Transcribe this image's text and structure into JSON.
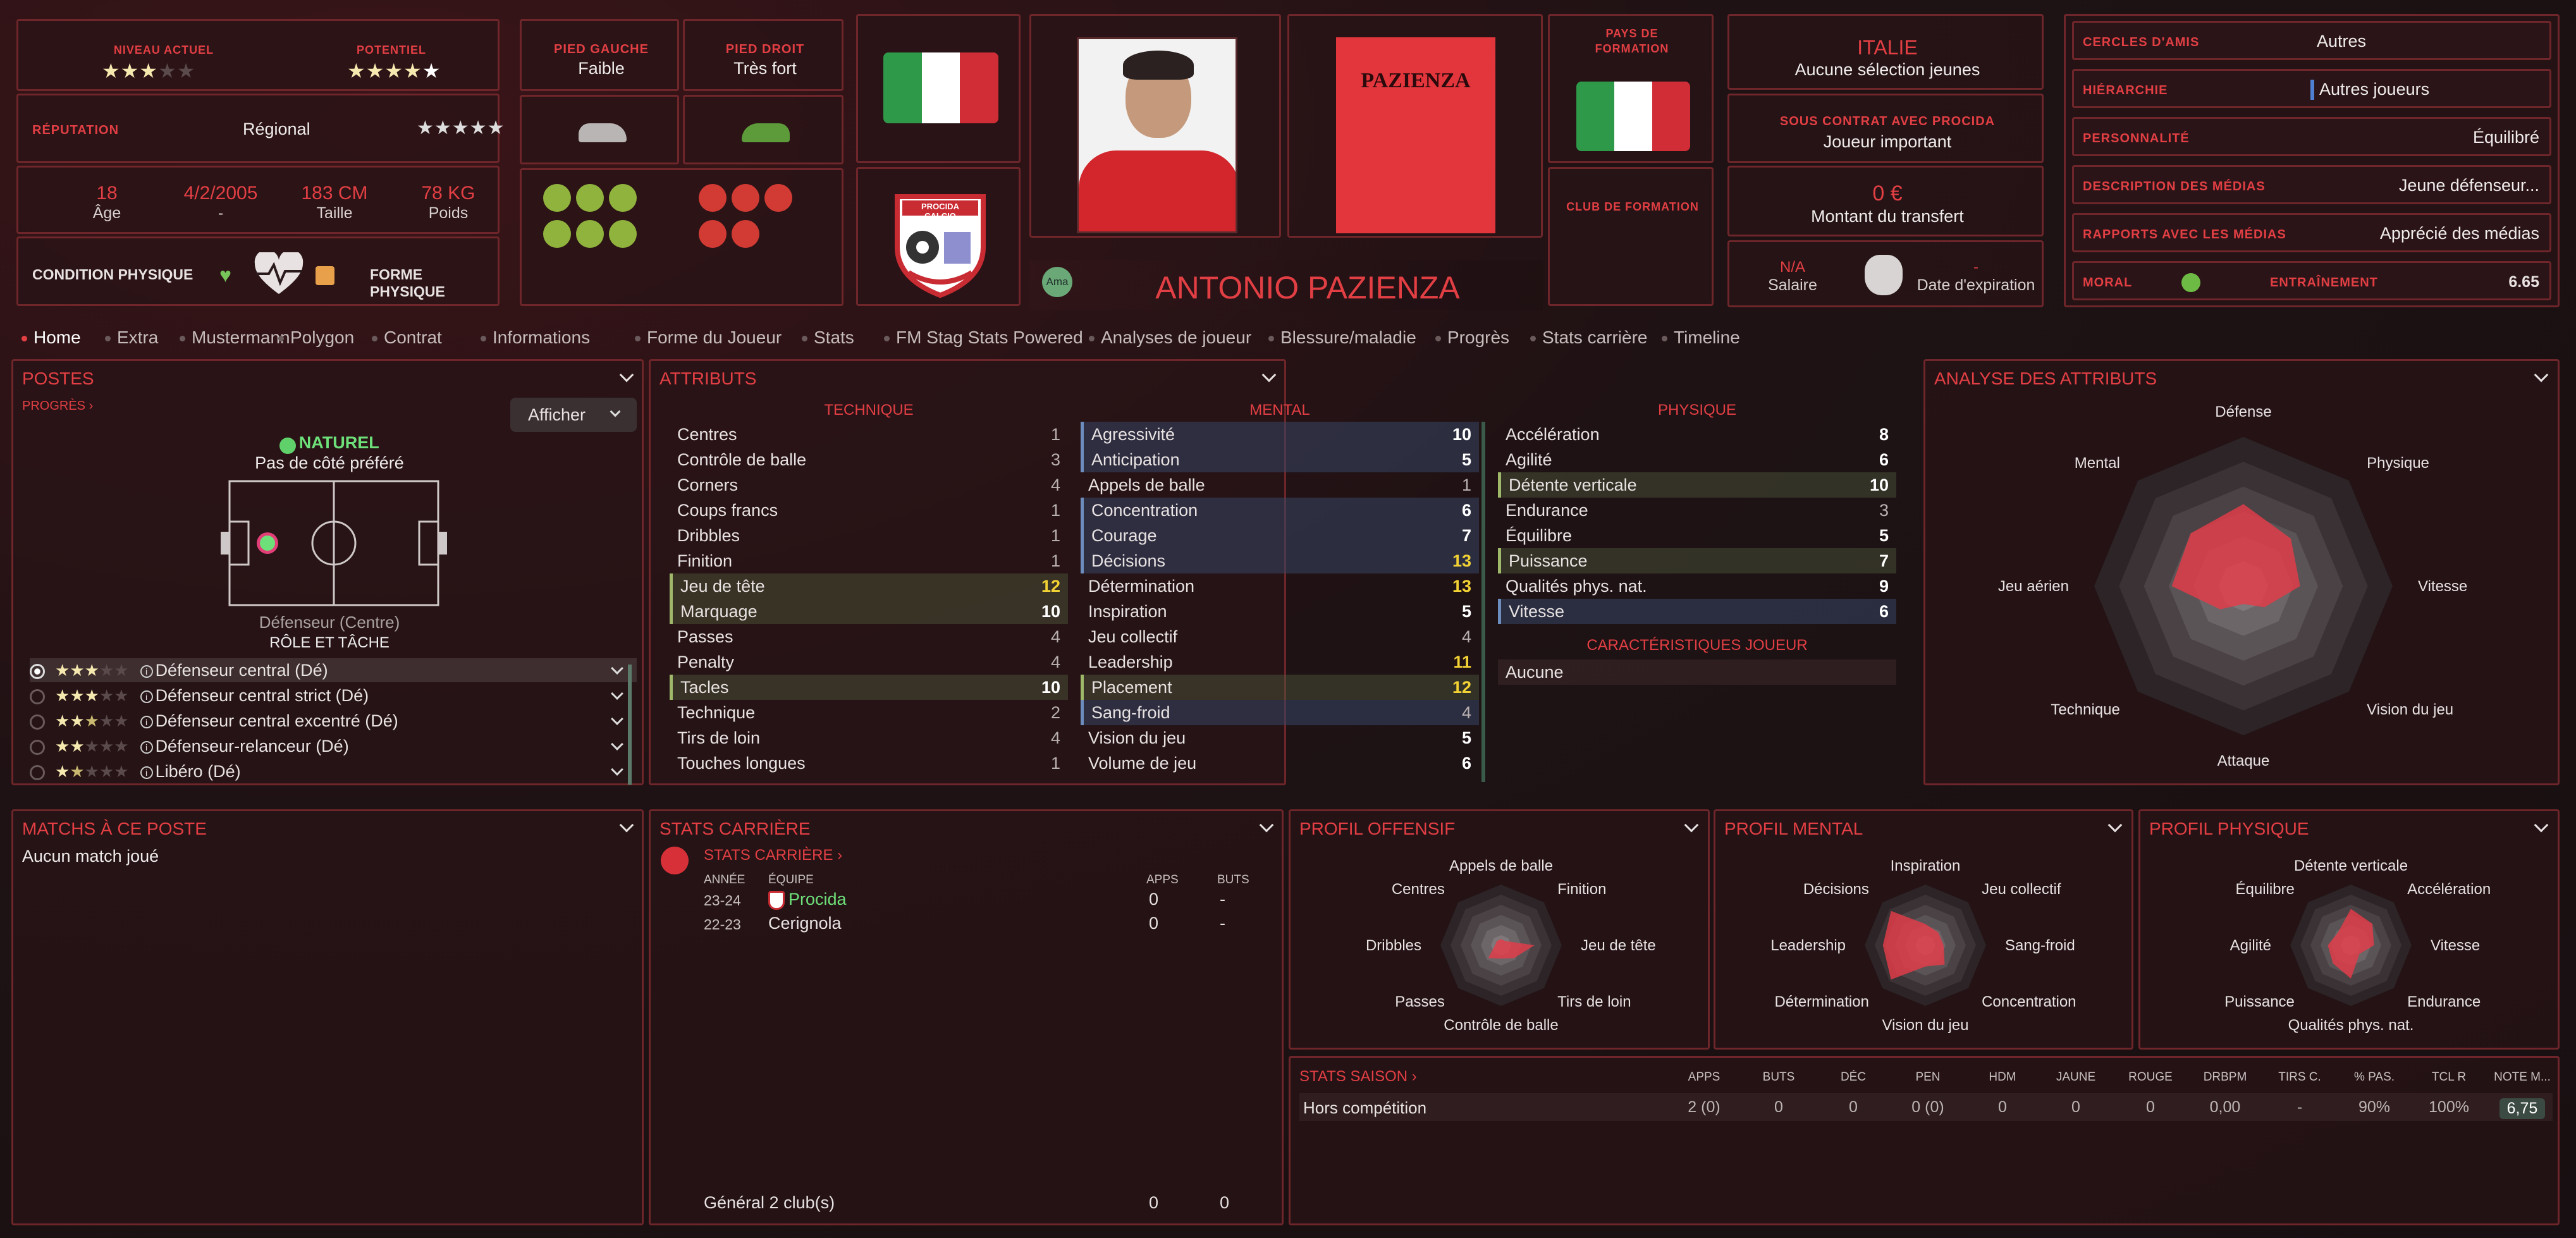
{
  "top": {
    "niveau_label": "NIVEAU ACTUEL",
    "potentiel_label": "POTENTIEL",
    "reputation_label": "RÉPUTATION",
    "reputation_value": "Régional",
    "age_value": "18",
    "age_label": "Âge",
    "dob_value": "4/2/2005",
    "dob_label": "-",
    "height_value": "183 CM",
    "height_label": "Taille",
    "weight_value": "78 KG",
    "weight_label": "Poids",
    "condition_label": "CONDITION PHYSIQUE",
    "forme_label": "FORME PHYSIQUE",
    "pied_gauche_label": "PIED GAUCHE",
    "pied_gauche_value": "Faible",
    "pied_droit_label": "PIED DROIT",
    "pied_droit_value": "Très fort",
    "club_badge_text": "PROCIDA CALCIO",
    "ama_label": "Ama",
    "player_name": "ANTONIO PAZIENZA",
    "shirt_name": "PAZIENZA",
    "pays_formation_label": "PAYS DE FORMATION",
    "club_formation_label": "CLUB DE FORMATION",
    "nation": "ITALIE",
    "selection": "Aucune sélection jeunes",
    "contrat_label": "SOUS CONTRAT AVEC PROCIDA",
    "contrat_value": "Joueur important",
    "transfert_value": "0 €",
    "transfert_label": "Montant du transfert",
    "salaire_value": "N/A",
    "salaire_label": "Salaire",
    "expiration_value": "-",
    "expiration_label": "Date d'expiration",
    "cercles_label": "CERCLES D'AMIS",
    "cercles_value": "Autres",
    "hierarchie_label": "HIÉRARCHIE",
    "hierarchie_value": "Autres joueurs",
    "personnalite_label": "PERSONNALITÉ",
    "personnalite_value": "Équilibré",
    "desc_medias_label": "DESCRIPTION DES MÉDIAS",
    "desc_medias_value": "Jeune défenseur...",
    "rapports_label": "RAPPORTS AVEC LES MÉDIAS",
    "rapports_value": "Apprécié des médias",
    "moral_label": "MORAL",
    "entrainement_label": "ENTRAÎNEMENT",
    "entrainement_value": "6.65",
    "flag_colors": [
      "#2e9a49",
      "#ffffff",
      "#d12d36"
    ]
  },
  "tabs": [
    "Home",
    "Extra",
    "Mustermann",
    "Polygon",
    "Contrat",
    "Informations",
    "Forme du Joueur",
    "Stats",
    "FM Stag Stats Powered",
    "Analyses de joueur",
    "Blessure/maladie",
    "Progrès",
    "Stats carrière",
    "Timeline"
  ],
  "postes": {
    "title": "POSTES",
    "progres": "PROGRÈS",
    "afficher": "Afficher",
    "naturel": "NATUREL",
    "cote": "Pas de côté préféré",
    "position": "Défenseur (Centre)",
    "role_label": "RÔLE ET TÂCHE",
    "roles": [
      {
        "name": "Défenseur central (Dé)",
        "stars": 3
      },
      {
        "name": "Défenseur central strict (Dé)",
        "stars": 3
      },
      {
        "name": "Défenseur central excentré (Dé)",
        "stars": 2.5
      },
      {
        "name": "Défenseur-relanceur (Dé)",
        "stars": 2
      },
      {
        "name": "Libéro (Dé)",
        "stars": 1.5
      }
    ]
  },
  "attributs": {
    "title": "ATTRIBUTS",
    "technique_label": "TECHNIQUE",
    "mental_label": "MENTAL",
    "physique_label": "PHYSIQUE",
    "caract_label": "CARACTÉRISTIQUES JOUEUR",
    "caract_value": "Aucune",
    "technique": [
      [
        "Centres",
        "1"
      ],
      [
        "Contrôle de balle",
        "3"
      ],
      [
        "Corners",
        "4"
      ],
      [
        "Coups francs",
        "1"
      ],
      [
        "Dribbles",
        "1"
      ],
      [
        "Finition",
        "1"
      ],
      [
        "Jeu de tête",
        "12"
      ],
      [
        "Marquage",
        "10"
      ],
      [
        "Passes",
        "4"
      ],
      [
        "Penalty",
        "4"
      ],
      [
        "Tacles",
        "10"
      ],
      [
        "Technique",
        "2"
      ],
      [
        "Tirs de loin",
        "4"
      ],
      [
        "Touches longues",
        "1"
      ]
    ],
    "mental": [
      [
        "Agressivité",
        "10"
      ],
      [
        "Anticipation",
        "5"
      ],
      [
        "Appels de balle",
        "1"
      ],
      [
        "Concentration",
        "6"
      ],
      [
        "Courage",
        "7"
      ],
      [
        "Décisions",
        "13"
      ],
      [
        "Détermination",
        "13"
      ],
      [
        "Inspiration",
        "5"
      ],
      [
        "Jeu collectif",
        "4"
      ],
      [
        "Leadership",
        "11"
      ],
      [
        "Placement",
        "12"
      ],
      [
        "Sang-froid",
        "4"
      ],
      [
        "Vision du jeu",
        "5"
      ],
      [
        "Volume de jeu",
        "6"
      ]
    ],
    "physique": [
      [
        "Accélération",
        "8"
      ],
      [
        "Agilité",
        "6"
      ],
      [
        "Détente verticale",
        "10"
      ],
      [
        "Endurance",
        "3"
      ],
      [
        "Équilibre",
        "5"
      ],
      [
        "Puissance",
        "7"
      ],
      [
        "Qualités phys. nat.",
        "9"
      ],
      [
        "Vitesse",
        "6"
      ]
    ]
  },
  "analyse": {
    "title": "ANALYSE DES ATTRIBUTS",
    "axes": [
      "Défense",
      "Physique",
      "Vitesse",
      "Vision du jeu",
      "Attaque",
      "Technique",
      "Jeu aérien",
      "Mental"
    ],
    "values": [
      0.55,
      0.45,
      0.38,
      0.2,
      0.12,
      0.22,
      0.48,
      0.5
    ]
  },
  "matchs": {
    "title": "MATCHS À CE POSTE",
    "text": "Aucun match joué"
  },
  "carriere": {
    "title": "STATS CARRIÈRE",
    "link": "STATS CARRIÈRE",
    "col_annee": "ANNÉE",
    "col_equipe": "ÉQUIPE",
    "col_apps": "APPS",
    "col_buts": "BUTS",
    "rows": [
      [
        "23-24",
        "Procida",
        "0",
        "-"
      ],
      [
        "22-23",
        "Cerignola",
        "0",
        "-"
      ]
    ],
    "total_label": "Général 2 club(s)",
    "total_apps": "0",
    "total_buts": "0"
  },
  "offensif": {
    "title": "PROFIL OFFENSIF",
    "axes": [
      "Appels de balle",
      "Finition",
      "Jeu de tête",
      "Tirs de loin",
      "Contrôle de balle",
      "Passes",
      "Dribbles",
      "Centres"
    ],
    "values": [
      0.1,
      0.1,
      0.55,
      0.3,
      0.22,
      0.3,
      0.1,
      0.1
    ]
  },
  "mentalp": {
    "title": "PROFIL MENTAL",
    "axes": [
      "Inspiration",
      "Jeu collectif",
      "Sang-froid",
      "Concentration",
      "Vision du jeu",
      "Détermination",
      "Leadership",
      "Décisions"
    ],
    "values": [
      0.35,
      0.3,
      0.3,
      0.45,
      0.35,
      0.8,
      0.7,
      0.8
    ]
  },
  "physiquep": {
    "title": "PROFIL PHYSIQUE",
    "axes": [
      "Détente verticale",
      "Accélération",
      "Vitesse",
      "Endurance",
      "Qualités phys. nat.",
      "Puissance",
      "Agilité",
      "Équilibre"
    ],
    "values": [
      0.6,
      0.5,
      0.38,
      0.2,
      0.55,
      0.42,
      0.38,
      0.3
    ]
  },
  "saison": {
    "title": "STATS SAISON",
    "headers": [
      "APPS",
      "BUTS",
      "DÉC",
      "PEN",
      "HDM",
      "JAUNE",
      "ROUGE",
      "DRBPM",
      "TIRS C.",
      "% PAS.",
      "TCL R",
      "NOTE M..."
    ],
    "row_label": "Hors compétition",
    "row": [
      "2 (0)",
      "0",
      "0",
      "0 (0)",
      "0",
      "0",
      "0",
      "0,00",
      "-",
      "90%",
      "100%",
      "6,75"
    ]
  }
}
